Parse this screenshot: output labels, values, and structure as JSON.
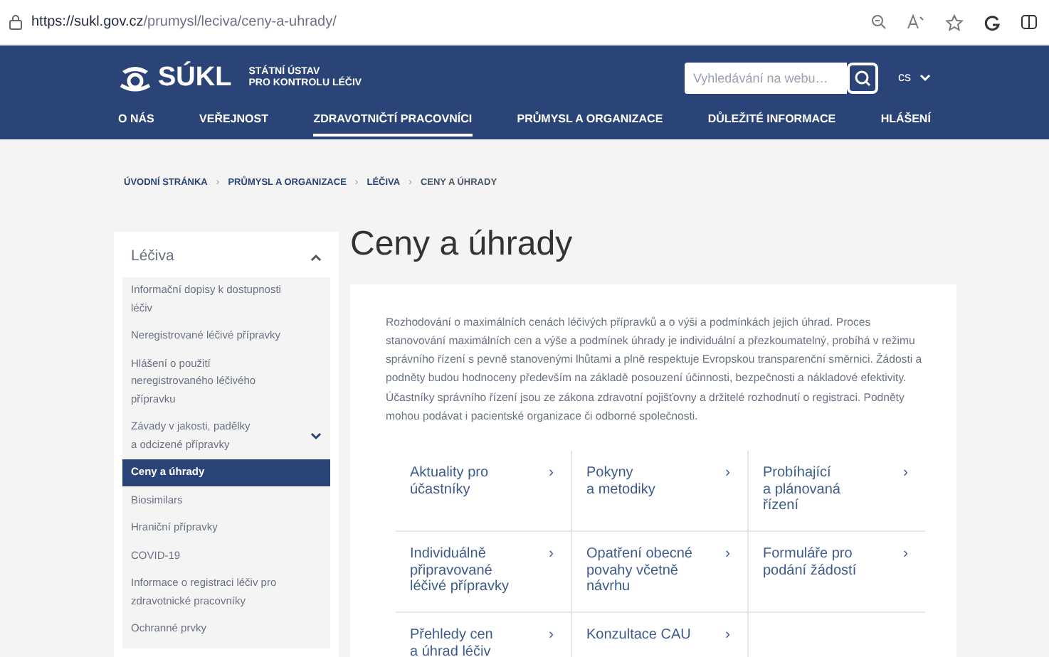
{
  "browser": {
    "url_host": "https://sukl.gov.cz",
    "url_path": "/prumysl/leciva/ceny-a-uhrady/"
  },
  "header": {
    "logo_text": "SÚKL",
    "logo_subtitle": [
      "STÁTNÍ ÚSTAV",
      "PRO KONTROLU LÉČIV"
    ],
    "search": {
      "placeholder": "Vyhledávání na webu…"
    },
    "language": "cs"
  },
  "nav": [
    {
      "label": "O NÁS",
      "selected": false
    },
    {
      "label": "VEŘEJNOST",
      "selected": false
    },
    {
      "label": "ZDRAVOTNIČTÍ PRACOVNÍCI",
      "selected": true
    },
    {
      "label": "PRŮMYSL A ORGANIZACE",
      "selected": false
    },
    {
      "label": "DŮLEŽITÉ INFORMACE",
      "selected": false
    },
    {
      "label": "HLÁŠENÍ",
      "selected": false
    }
  ],
  "breadcrumb": [
    "ÚVODNÍ STRÁNKA",
    "PRŮMYSL A ORGANIZACE",
    "LÉČIVA",
    "CENY A ÚHRADY"
  ],
  "sidebar": {
    "title": "Léčiva",
    "expanded": true,
    "items": [
      {
        "label": "Informační dopisy k dostupnosti léčiv",
        "selected": false
      },
      {
        "label": "Neregistrované léčivé přípravky",
        "selected": false
      },
      {
        "label": "Hlášení o použití neregistrovaného léčivého přípravku",
        "selected": false
      },
      {
        "label": "Závady v jakosti, padělky a odcizené přípravky",
        "selected": false,
        "expanded": false
      },
      {
        "label": "Ceny a úhrady",
        "selected": true
      },
      {
        "label": "Biosimilars",
        "selected": false
      },
      {
        "label": "Hraniční přípravky",
        "selected": false
      },
      {
        "label": "COVID-19",
        "selected": false
      },
      {
        "label": "Informace o registraci léčiv pro zdravotnické pracovníky",
        "selected": false
      },
      {
        "label": "Ochranné prvky",
        "selected": false
      }
    ]
  },
  "page_title": "Ceny a úhrady",
  "intro": "Rozhodování o maximálních cenách léčivých přípravků a o výši a podmínkách jejich úhrad. Proces stanovování maximálních cen a výše a podmínek úhrady je individuální a přezkoumatelný, probíhá v režimu správního řízení s pevně stanovenými lhůtami a plně respektuje Evropskou transparenční směrnici. Žádosti a podněty budou hodnoceny především na základě posouzení účinnosti, bezpečnosti a nákladové efektivity. Účastníky správního řízení jsou ze zákona zdravotní pojišťovny a držitelé rozhodnutí o registraci. Podněty mohou podávat i pacientské organizace či odborné společnosti.",
  "links": [
    {
      "label": "Aktuality pro účastníky",
      "arrow": "›"
    },
    {
      "label": "Pokyny a metodiky",
      "arrow": "›"
    },
    {
      "label": "Probíhající a plánovaná řízení",
      "arrow": "›"
    },
    {
      "label": "Individuálně připravované léčivé přípravky",
      "arrow": "›"
    },
    {
      "label": "Opatření obecné povahy včetně návrhu",
      "arrow": "›"
    },
    {
      "label": "Formuláře pro podání žádostí",
      "arrow": "›"
    },
    {
      "label": "Přehledy cen a úhrad léčiv",
      "arrow": "›"
    },
    {
      "label": "Konzultace CAU",
      "arrow": "›"
    }
  ]
}
